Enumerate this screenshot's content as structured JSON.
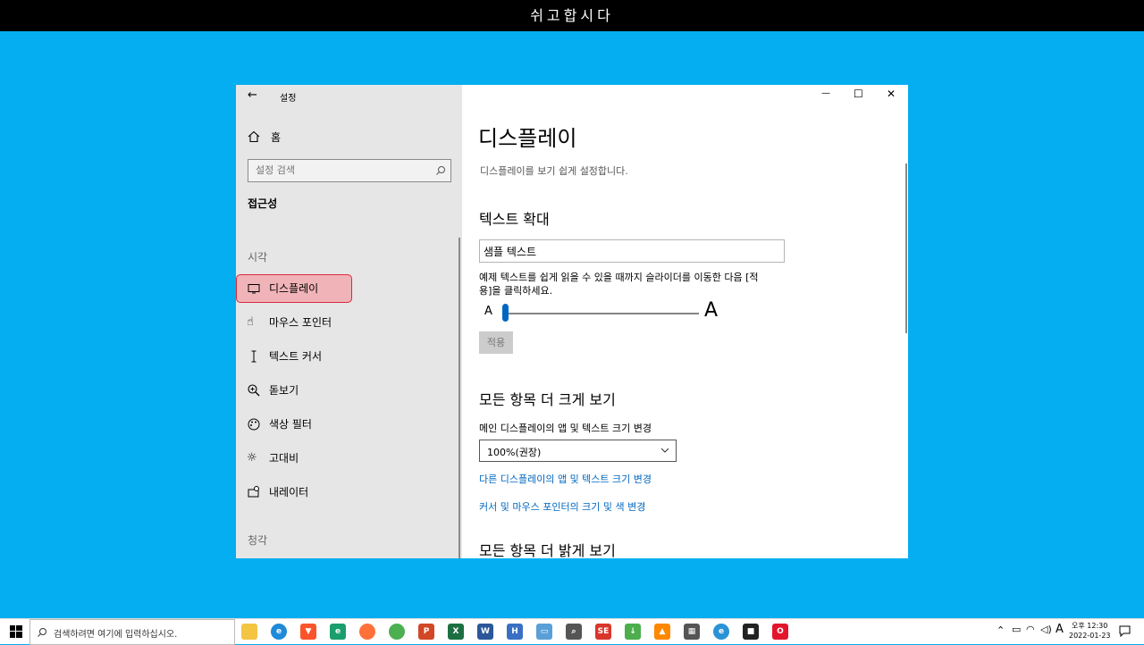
{
  "banner": {
    "text": "쉬고합시다"
  },
  "window": {
    "title": "설정",
    "controls": {
      "minimize": "—",
      "maximize": "☐",
      "close": "✕"
    }
  },
  "sidebar": {
    "home_label": "홈",
    "search_placeholder": "설정 검색",
    "category": "접근성",
    "section_vision": "시각",
    "items": [
      {
        "label": "디스플레이",
        "icon": "monitor-icon",
        "active": true
      },
      {
        "label": "마우스 포인터",
        "icon": "hand-pointer-icon"
      },
      {
        "label": "텍스트 커서",
        "icon": "text-cursor-icon"
      },
      {
        "label": "돋보기",
        "icon": "magnifier-icon"
      },
      {
        "label": "색상 필터",
        "icon": "palette-icon"
      },
      {
        "label": "고대비",
        "icon": "sun-icon"
      },
      {
        "label": "내레이터",
        "icon": "narrator-icon"
      }
    ],
    "section_hearing": "청각"
  },
  "main": {
    "title": "디스플레이",
    "subtitle": "디스플레이를 보기 쉽게 설정합니다.",
    "text_size": {
      "heading": "텍스트 확대",
      "sample_value": "샘플 텍스트",
      "description_line1": "예제 텍스트를 쉽게 읽을 수 있을 때까지 슬라이더를 이동한 다음 [적",
      "description_line2": "용]을 클릭하세요.",
      "small_a": "A",
      "large_a": "A",
      "slider_level": 0.0,
      "apply_label": "적용"
    },
    "scale": {
      "heading": "모든 항목 더 크게 보기",
      "label": "메인 디스플레이의 앱 및 텍스트 크기 변경",
      "selected": "100%(권장)",
      "link1": "다른 디스플레이의 앱 및 텍스트 크기 변경",
      "link2": "커서 및 마우스 포인터의 크기 및 색 변경"
    },
    "brightness": {
      "heading": "모든 항목 더 밝게 보기"
    }
  },
  "taskbar": {
    "search_placeholder": "검색하려면 여기에 입력하십시오.",
    "apps": [
      {
        "name": "file-explorer-icon",
        "color": "#f4c542",
        "glyph": ""
      },
      {
        "name": "edge-icon",
        "color": "#1e8ad8",
        "glyph": "e"
      },
      {
        "name": "brave-icon",
        "color": "#fb542b",
        "glyph": "▼"
      },
      {
        "name": "edge-dev-icon",
        "color": "#1a9e6e",
        "glyph": "e"
      },
      {
        "name": "firefox-icon",
        "color": "#ff7139",
        "glyph": ""
      },
      {
        "name": "chrome-icon",
        "color": "#4caf50",
        "glyph": ""
      },
      {
        "name": "powerpoint-icon",
        "color": "#d24726",
        "glyph": "P"
      },
      {
        "name": "excel-icon",
        "color": "#1d6f42",
        "glyph": "X"
      },
      {
        "name": "word-icon",
        "color": "#2b579a",
        "glyph": "W"
      },
      {
        "name": "hwp-icon",
        "color": "#3a70c4",
        "glyph": "H"
      },
      {
        "name": "remote-desktop-icon",
        "color": "#5aa0d8",
        "glyph": "▭"
      },
      {
        "name": "search-app-icon",
        "color": "#555555",
        "glyph": "⌕"
      },
      {
        "name": "se-icon",
        "color": "#d9362c",
        "glyph": "SE"
      },
      {
        "name": "download-icon",
        "color": "#4cae4c",
        "glyph": "↓"
      },
      {
        "name": "vlc-icon",
        "color": "#ff8800",
        "glyph": "▲"
      },
      {
        "name": "calculator-icon",
        "color": "#555555",
        "glyph": "▦"
      },
      {
        "name": "browser-icon",
        "color": "#2a93d5",
        "glyph": "e"
      },
      {
        "name": "sticky-notes-icon",
        "color": "#222222",
        "glyph": "■"
      },
      {
        "name": "opera-icon",
        "color": "#e3152d",
        "glyph": "O"
      }
    ],
    "tray": {
      "input_indicator": "A",
      "time": "오후 12:30",
      "date": "2022-01-23"
    }
  }
}
